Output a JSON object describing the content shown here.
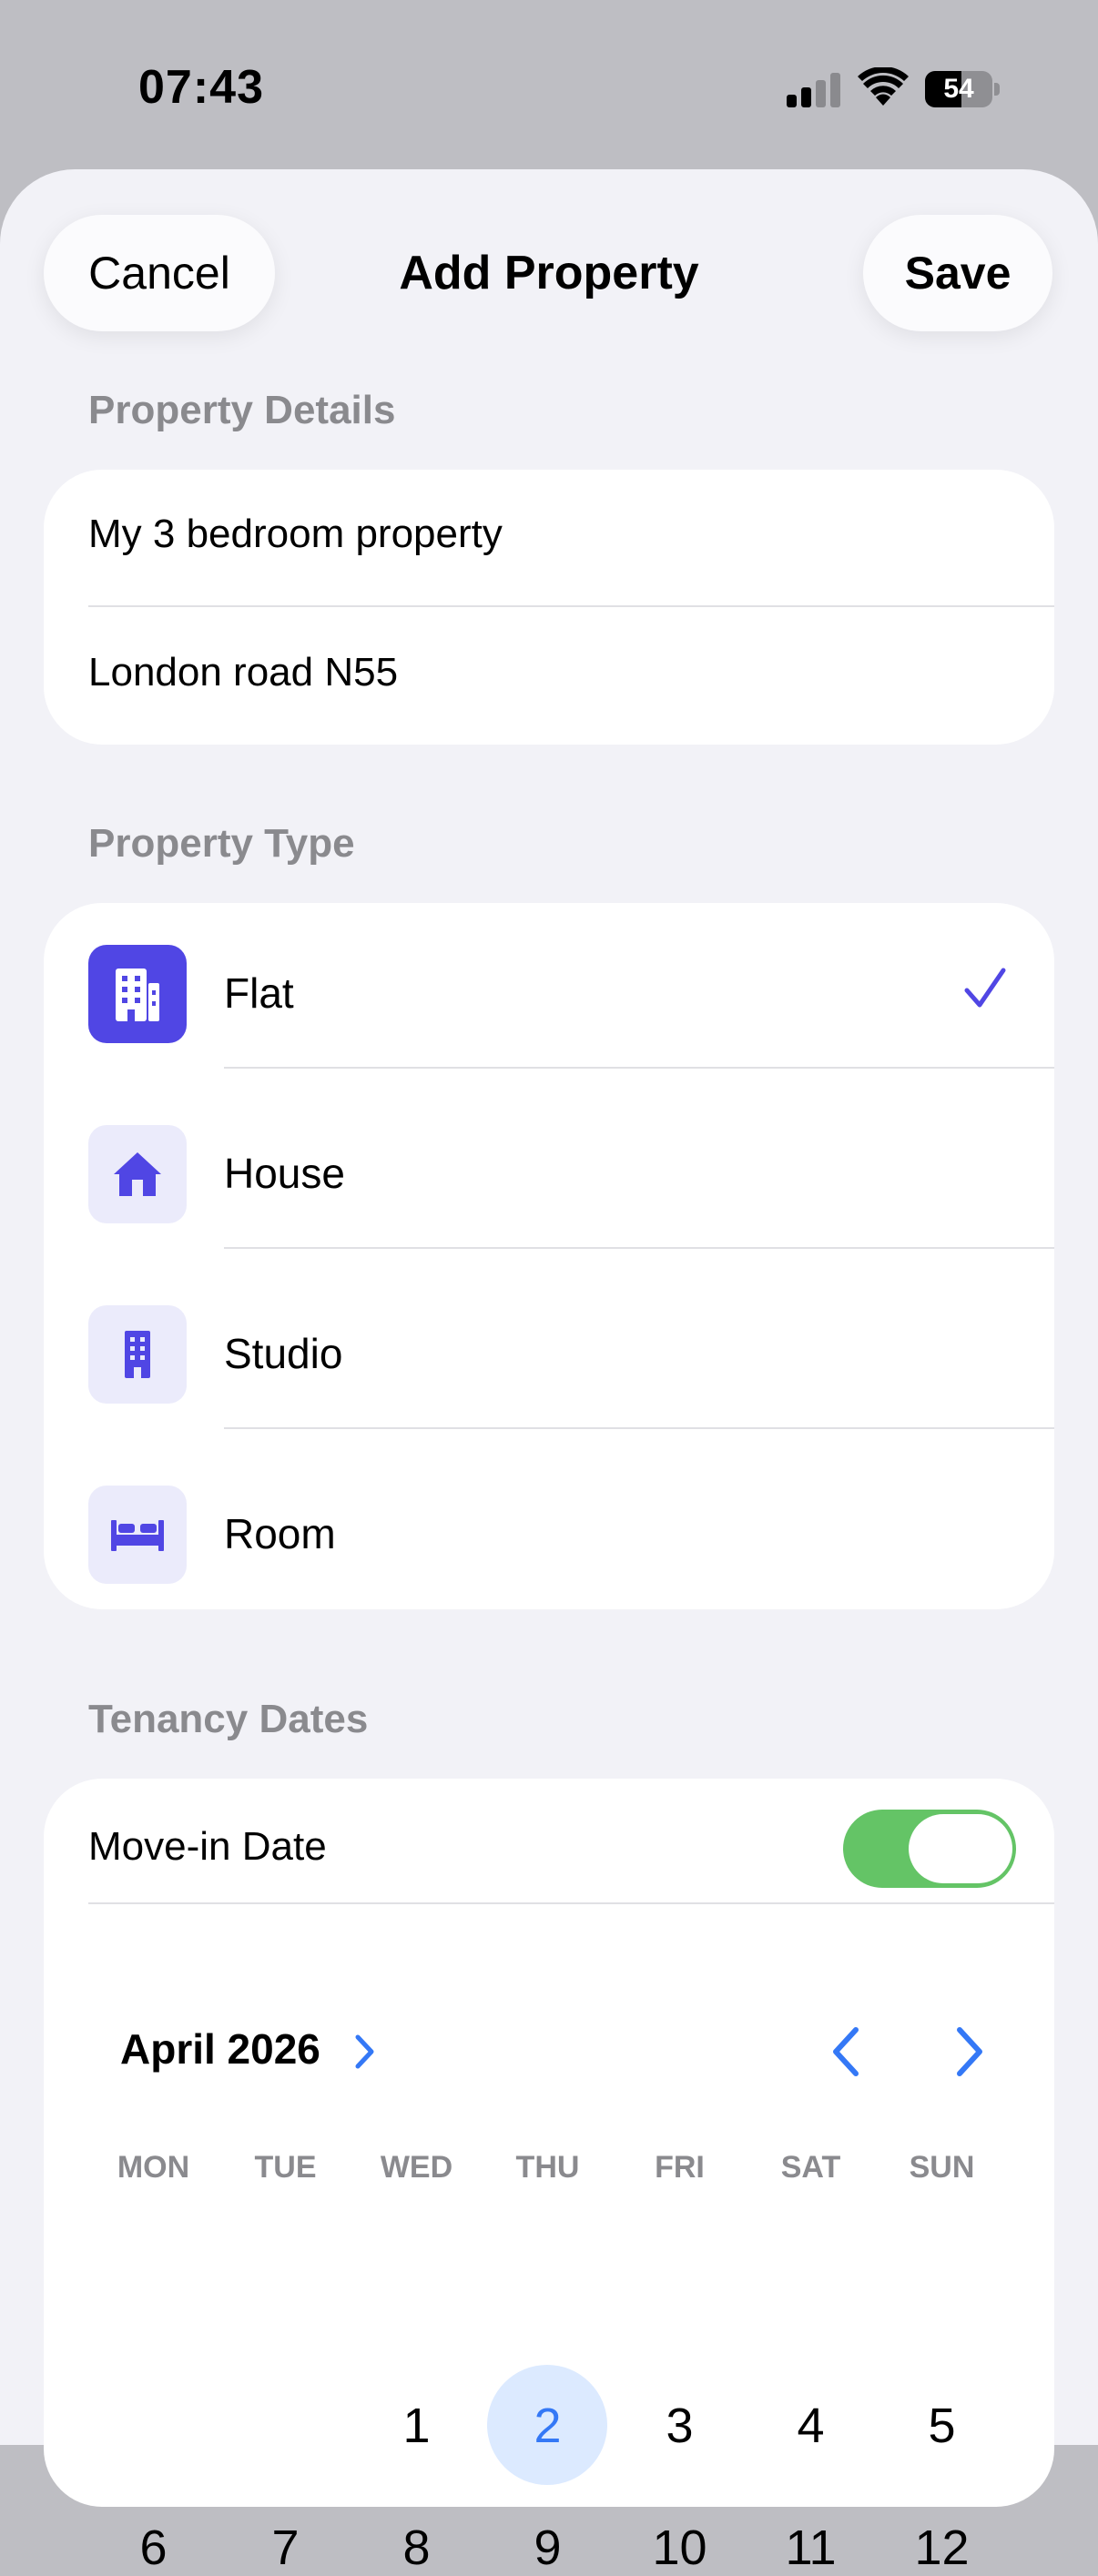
{
  "status_bar": {
    "time": "07:43",
    "battery": "54",
    "battery_level": 0.54
  },
  "nav": {
    "cancel_label": "Cancel",
    "title": "Add Property",
    "save_label": "Save"
  },
  "property_details": {
    "header": "Property Details",
    "name_value": "My 3 bedroom property",
    "address_value": "London road N55"
  },
  "property_type": {
    "header": "Property Type",
    "items": [
      {
        "label": "Flat",
        "icon": "building-icon",
        "selected": true
      },
      {
        "label": "House",
        "icon": "house-icon",
        "selected": false
      },
      {
        "label": "Studio",
        "icon": "studio-building-icon",
        "selected": false
      },
      {
        "label": "Room",
        "icon": "bed-icon",
        "selected": false
      }
    ]
  },
  "tenancy": {
    "header": "Tenancy Dates",
    "move_in_label": "Move-in Date",
    "move_in_enabled": true,
    "calendar": {
      "month_label": "April 2026",
      "weekdays": [
        "MON",
        "TUE",
        "WED",
        "THU",
        "FRI",
        "SAT",
        "SUN"
      ],
      "week1": [
        "1",
        "2",
        "3",
        "4",
        "5"
      ],
      "week2": [
        "6",
        "7",
        "8",
        "9",
        "10",
        "11",
        "12"
      ],
      "selected_day": "2"
    }
  },
  "colors": {
    "accent": "#5046e4",
    "link_blue": "#3478f6",
    "toggle_on": "#64c466",
    "today_bg": "#dceaff"
  }
}
